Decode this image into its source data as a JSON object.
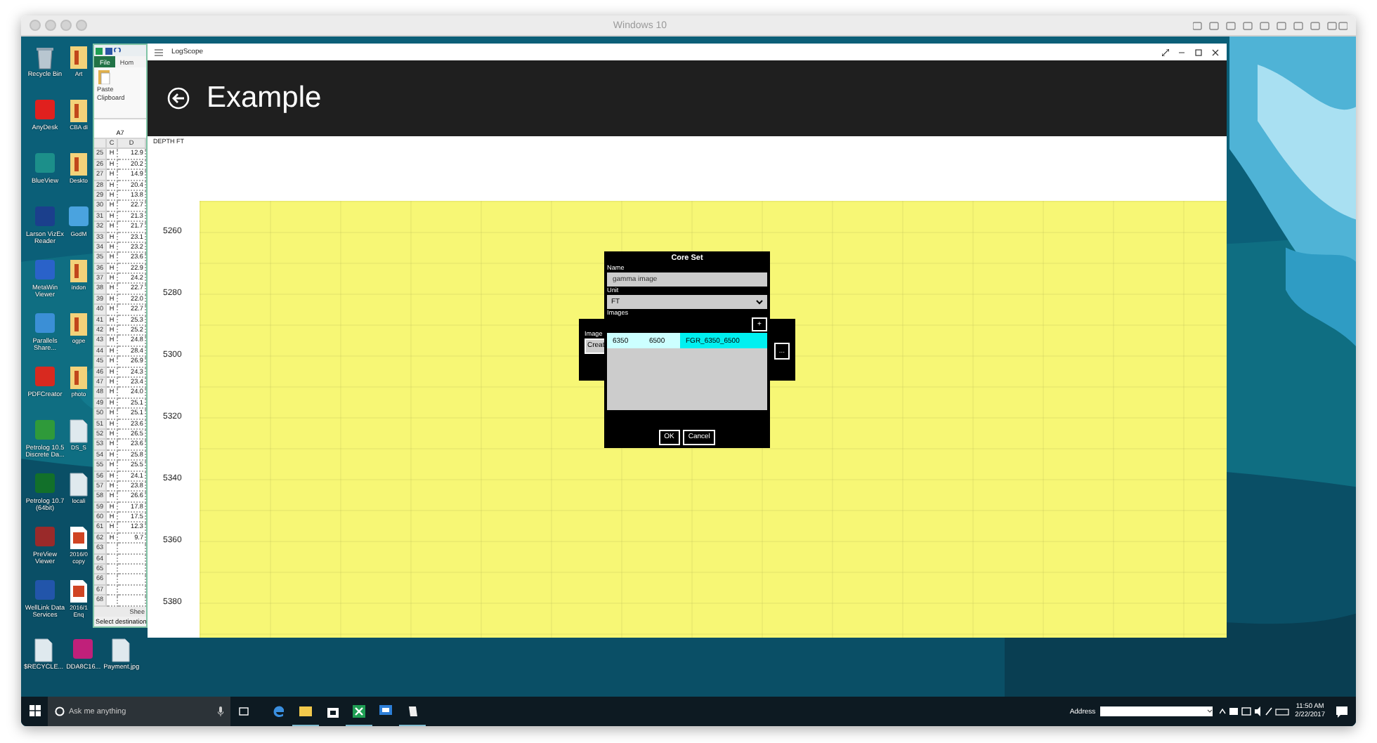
{
  "host_window": {
    "title": "Windows 10"
  },
  "desktop": {
    "icon_columns": [
      [
        {
          "label": "Recycle Bin",
          "kind": "bin"
        },
        {
          "label": "AnyDesk",
          "kind": "app",
          "color": "#e0201e"
        },
        {
          "label": "BlueView",
          "kind": "app",
          "color": "#1c8f8a"
        },
        {
          "label": "Larson VizEx Reader",
          "kind": "app",
          "color": "#1b3f8c"
        },
        {
          "label": "MetaWin Viewer",
          "kind": "app",
          "color": "#2a62c9"
        },
        {
          "label": "Parallels Share...",
          "kind": "app",
          "color": "#3b8fd6"
        },
        {
          "label": "PDFCreator",
          "kind": "app",
          "color": "#d8291f"
        },
        {
          "label": "Petrolog 10.5 Discrete Da...",
          "kind": "app",
          "color": "#2f9a3a"
        },
        {
          "label": "Petrolog 10.7 (64bit)",
          "kind": "app",
          "color": "#12702a"
        },
        {
          "label": "PreView Viewer",
          "kind": "app",
          "color": "#9a2a2a"
        },
        {
          "label": "WellLink Data Services",
          "kind": "app",
          "color": "#2255aa"
        }
      ],
      [
        {
          "label": "Art",
          "kind": "folder"
        },
        {
          "label": "CBA di",
          "kind": "folder"
        },
        {
          "label": "Deskto",
          "kind": "folder"
        },
        {
          "label": "GodM",
          "kind": "app",
          "color": "#4aa3df"
        },
        {
          "label": "indon",
          "kind": "folder"
        },
        {
          "label": "ogpe",
          "kind": "folder"
        },
        {
          "label": "photo",
          "kind": "folder"
        },
        {
          "label": "DS_S",
          "kind": "file"
        },
        {
          "label": "locali",
          "kind": "file"
        },
        {
          "label": "2016/0 copy",
          "kind": "pdf"
        },
        {
          "label": "2016/1 Enq",
          "kind": "pdf"
        }
      ]
    ],
    "bottom_icons": [
      {
        "label": "$RECYCLE...",
        "kind": "file"
      },
      {
        "label": "DDA8C16...",
        "kind": "app",
        "color": "#c0207a"
      },
      {
        "label": "Payment.jpg",
        "kind": "file"
      }
    ]
  },
  "excel": {
    "file_tab": "File",
    "home_tab": "Hom",
    "paste_label": "Paste",
    "group_label": "Clipboard",
    "name_box": "A7",
    "columns": [
      "C",
      "D"
    ],
    "rows": [
      {
        "n": "25",
        "c": "H",
        "d": "12.9"
      },
      {
        "n": "26",
        "c": "H",
        "d": "20.2"
      },
      {
        "n": "27",
        "c": "H",
        "d": "14.9"
      },
      {
        "n": "28",
        "c": "H",
        "d": "20.4"
      },
      {
        "n": "29",
        "c": "H",
        "d": "13.8"
      },
      {
        "n": "30",
        "c": "H",
        "d": "22.7"
      },
      {
        "n": "31",
        "c": "H",
        "d": "21.3"
      },
      {
        "n": "32",
        "c": "H",
        "d": "21.7"
      },
      {
        "n": "33",
        "c": "H",
        "d": "23.1"
      },
      {
        "n": "34",
        "c": "H",
        "d": "23.2"
      },
      {
        "n": "35",
        "c": "H",
        "d": "23.6"
      },
      {
        "n": "36",
        "c": "H",
        "d": "22.9"
      },
      {
        "n": "37",
        "c": "H",
        "d": "24.2"
      },
      {
        "n": "38",
        "c": "H",
        "d": "22.7"
      },
      {
        "n": "39",
        "c": "H",
        "d": "22.0"
      },
      {
        "n": "40",
        "c": "H",
        "d": "22.7"
      },
      {
        "n": "41",
        "c": "H",
        "d": "25.3"
      },
      {
        "n": "42",
        "c": "H",
        "d": "25.2"
      },
      {
        "n": "43",
        "c": "H",
        "d": "24.8"
      },
      {
        "n": "44",
        "c": "H",
        "d": "28.4"
      },
      {
        "n": "45",
        "c": "H",
        "d": "26.9"
      },
      {
        "n": "46",
        "c": "H",
        "d": "24.3"
      },
      {
        "n": "47",
        "c": "H",
        "d": "23.4"
      },
      {
        "n": "48",
        "c": "H",
        "d": "24.0"
      },
      {
        "n": "49",
        "c": "H",
        "d": "25.1"
      },
      {
        "n": "50",
        "c": "H",
        "d": "25.1"
      },
      {
        "n": "51",
        "c": "H",
        "d": "23.6"
      },
      {
        "n": "52",
        "c": "H",
        "d": "26.5"
      },
      {
        "n": "53",
        "c": "H",
        "d": "23.6"
      },
      {
        "n": "54",
        "c": "H",
        "d": "25.8"
      },
      {
        "n": "55",
        "c": "H",
        "d": "25.5"
      },
      {
        "n": "56",
        "c": "H",
        "d": "24.1"
      },
      {
        "n": "57",
        "c": "H",
        "d": "23.8"
      },
      {
        "n": "58",
        "c": "H",
        "d": "26.6"
      },
      {
        "n": "59",
        "c": "H",
        "d": "17.8"
      },
      {
        "n": "60",
        "c": "H",
        "d": "17.5"
      },
      {
        "n": "61",
        "c": "H",
        "d": "12.3"
      },
      {
        "n": "62",
        "c": "H",
        "d": "9.7"
      }
    ],
    "empty_rows": [
      "63",
      "64",
      "65",
      "66",
      "67",
      "68"
    ],
    "sheet_tab": "Shee",
    "status": "Select destination"
  },
  "logscope": {
    "title": "LogScope",
    "page_title": "Example",
    "depth_header": "DEPTH FT",
    "depth_labels": [
      "5260",
      "5280",
      "5300",
      "5320",
      "5340",
      "5360",
      "5380"
    ],
    "image_panel": {
      "label": "Image",
      "button": "Creat",
      "more_button": "..."
    },
    "dialog": {
      "title": "Core Set",
      "name_label": "Name",
      "name_value": "gamma image",
      "unit_label": "Unit",
      "unit_value": "FT",
      "images_label": "Images",
      "add_button": "+",
      "rows": [
        {
          "cells": [
            "6350",
            "6500",
            "FGR_6350_6500"
          ],
          "selected": true
        }
      ],
      "ok": "OK",
      "cancel": "Cancel"
    }
  },
  "taskbar": {
    "search_placeholder": "Ask me anything",
    "apps": [
      {
        "kind": "edge",
        "running": false
      },
      {
        "kind": "explorer",
        "running": true
      },
      {
        "kind": "store",
        "running": false
      },
      {
        "kind": "excel",
        "running": true
      },
      {
        "kind": "remote",
        "running": false
      },
      {
        "kind": "logscope",
        "running": true
      }
    ],
    "address_label": "Address",
    "time": "11:50 AM",
    "date": "2/22/2017"
  }
}
